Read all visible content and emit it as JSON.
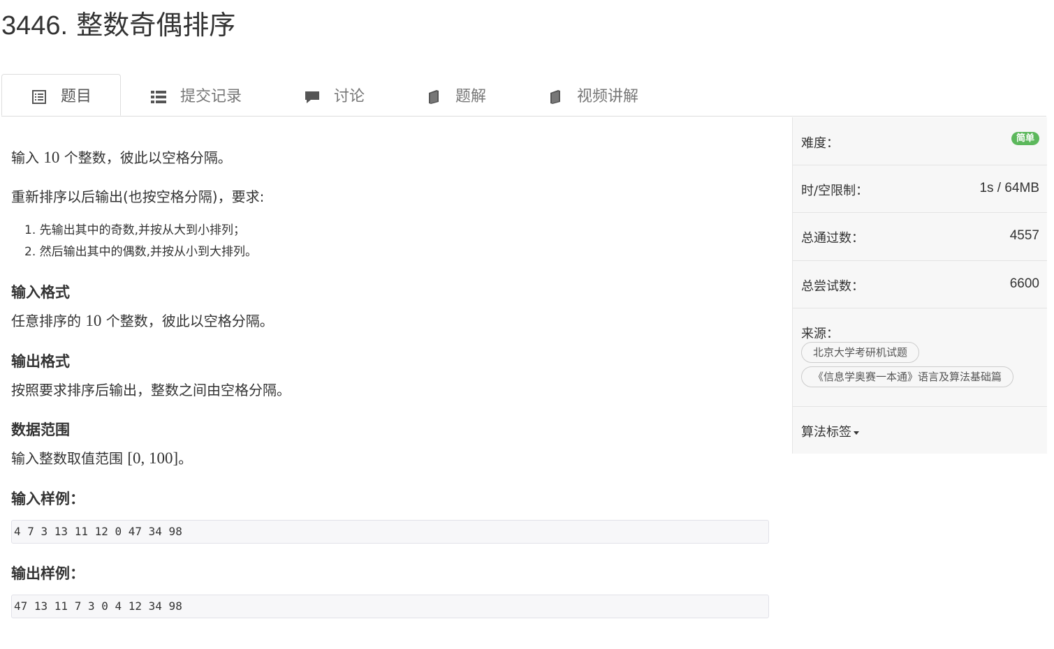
{
  "problem": {
    "number": "3446.",
    "name": "整数奇偶排序"
  },
  "tabs": [
    {
      "label": "题目",
      "icon": "list-alt-icon",
      "active": true
    },
    {
      "label": "提交记录",
      "icon": "th-list-icon",
      "active": false
    },
    {
      "label": "讨论",
      "icon": "comment-icon",
      "active": false
    },
    {
      "label": "题解",
      "icon": "book-icon",
      "active": false
    },
    {
      "label": "视频讲解",
      "icon": "book-icon",
      "active": false
    }
  ],
  "statement": {
    "line1_pre": "输入 ",
    "line1_num": "10",
    "line1_post": " 个整数，彼此以空格分隔。",
    "line2": "重新排序以后输出(也按空格分隔)，要求:",
    "requirements": [
      "1. 先输出其中的奇数,并按从大到小排列；",
      "2. 然后输出其中的偶数,并按从小到大排列。"
    ]
  },
  "sections": {
    "input_format_title": "输入格式",
    "input_format_pre": "任意排序的 ",
    "input_format_num": "10",
    "input_format_post": " 个整数，彼此以空格分隔。",
    "output_format_title": "输出格式",
    "output_format_text": "按照要求排序后输出，整数之间由空格分隔。",
    "range_title": "数据范围",
    "range_pre": "输入整数取值范围 ",
    "range_math": "[0, 100]",
    "range_post": "。",
    "sample_input_title": "输入样例：",
    "sample_input": "4 7 3 13 11 12 0 47 34 98",
    "sample_output_title": "输出样例：",
    "sample_output": "47 13 11 7 3 0 4 12 34 98"
  },
  "sidebar": {
    "difficulty_label": "难度：",
    "difficulty_value": "简单",
    "difficulty_color": "#5cb85c",
    "limit_label": "时/空限制：",
    "limit_value": "1s / 64MB",
    "accepted_label": "总通过数：",
    "accepted_value": "4557",
    "attempts_label": "总尝试数：",
    "attempts_value": "6600",
    "source_label": "来源：",
    "sources": [
      "北京大学考研机试题",
      "《信息学奥赛一本通》语言及算法基础篇"
    ],
    "tags_label": "算法标签"
  }
}
